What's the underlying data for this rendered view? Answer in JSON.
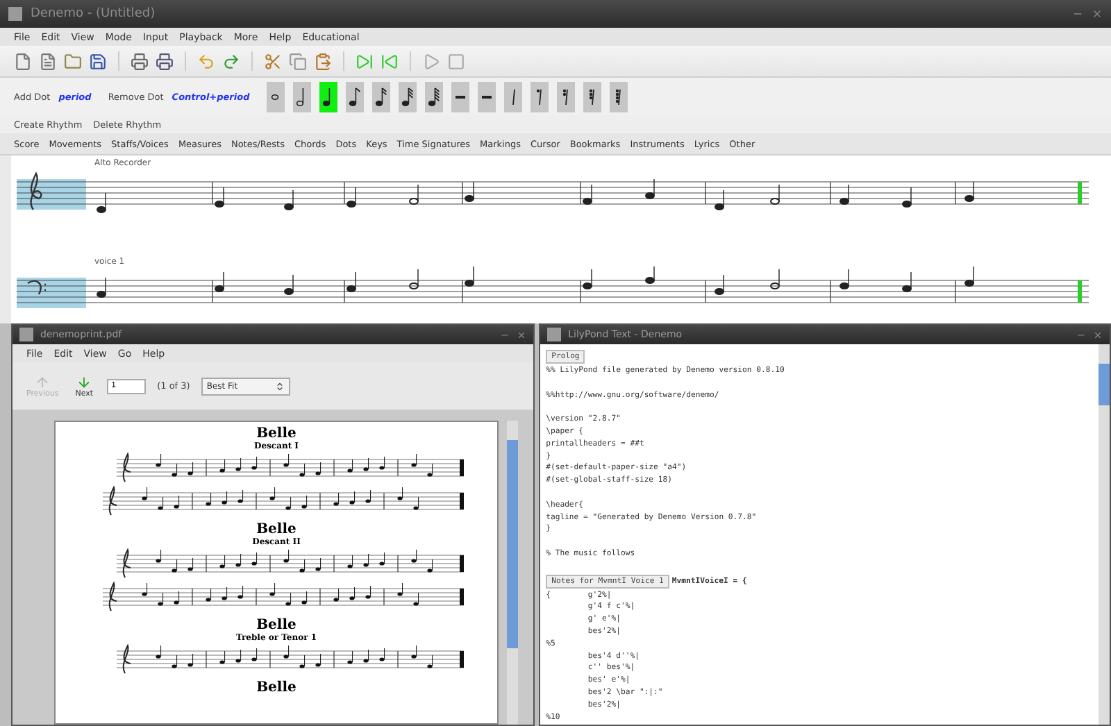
{
  "window": {
    "title": "Denemo - (Untitled)"
  },
  "menu": [
    "File",
    "Edit",
    "View",
    "Mode",
    "Input",
    "Playback",
    "More",
    "Help",
    "Educational"
  ],
  "rhythm_bar": {
    "add_dot": {
      "label": "Add Dot",
      "shortcut": "period"
    },
    "remove_dot": {
      "label": "Remove Dot",
      "shortcut": "Control+period"
    },
    "buttons": [
      {
        "kind": "whole-note",
        "selected": false
      },
      {
        "kind": "half-note",
        "selected": false
      },
      {
        "kind": "quarter-note",
        "selected": true
      },
      {
        "kind": "eighth-note",
        "selected": false
      },
      {
        "kind": "sixteenth-note",
        "selected": false
      },
      {
        "kind": "thirty-second-note",
        "selected": false
      },
      {
        "kind": "sixty-fourth-note",
        "selected": false
      },
      {
        "kind": "whole-rest",
        "selected": false
      },
      {
        "kind": "half-rest",
        "selected": false
      },
      {
        "kind": "quarter-rest",
        "selected": false
      },
      {
        "kind": "eighth-rest",
        "selected": false
      },
      {
        "kind": "sixteenth-rest",
        "selected": false
      },
      {
        "kind": "thirty-second-rest",
        "selected": false
      },
      {
        "kind": "sixty-fourth-rest",
        "selected": false
      }
    ]
  },
  "rhythm_actions": [
    "Create Rhythm",
    "Delete Rhythm"
  ],
  "tabs": [
    "Score",
    "Movements",
    "Staffs/Voices",
    "Measures",
    "Notes/Rests",
    "Chords",
    "Dots",
    "Keys",
    "Time Signatures",
    "Markings",
    "Cursor",
    "Bookmarks",
    "Instruments",
    "Lyrics",
    "Other"
  ],
  "score": {
    "staves": [
      {
        "label": "Alto Recorder",
        "kind": "treble"
      },
      {
        "label": "voice 1",
        "kind": "bass"
      }
    ]
  },
  "pdf_viewer": {
    "title": "denemoprint.pdf",
    "menu": [
      "File",
      "Edit",
      "View",
      "Go",
      "Help"
    ],
    "previous": {
      "label": "Previous",
      "disabled": true
    },
    "next": {
      "label": "Next",
      "disabled": false
    },
    "page": "1",
    "page_count": "(1 of 3)",
    "zoom": "Best Fit",
    "sections": [
      {
        "title": "Belle",
        "subtitle": "Descant I",
        "staves": [
          {
            "kind": "opening"
          },
          {
            "kind": "continuation"
          }
        ]
      },
      {
        "title": "Belle",
        "subtitle": "Descant II",
        "staves": [
          {
            "kind": "opening"
          },
          {
            "kind": "continuation"
          }
        ]
      },
      {
        "title": "Belle",
        "subtitle": "Treble or Tenor 1",
        "staves": [
          {
            "kind": "opening"
          }
        ]
      },
      {
        "title": "Belle"
      }
    ]
  },
  "lilypond": {
    "title": "LilyPond Text - Denemo",
    "prolog_button": "Prolog",
    "blocks": [
      [
        "%% LilyPond file generated by Denemo version 0.8.10"
      ],
      [
        "%%http://www.gnu.org/software/denemo/"
      ],
      [
        "\\version \"2.8.7\"",
        "\\paper {",
        "printallheaders = ##t",
        "}",
        "#(set-default-paper-size \"a4\")",
        "#(set-global-staff-size 18)"
      ],
      [
        "\\header{",
        "tagline = \"Generated by Denemo Version 0.7.8\"",
        "}"
      ],
      [
        "% The music follows"
      ]
    ],
    "notes_button": "Notes for MvmntI Voice 1",
    "notes_heading": "MvmntIVoiceI = {",
    "body": [
      "{        g'2%|",
      "         g'4 f c'%|",
      "         g' e'%|",
      "         bes'2%|",
      "%5",
      "         bes'4 d''%|",
      "         c'' bes'%|",
      "         bes' e'%|",
      "         bes'2 \\bar \":|:\"",
      "         bes'2%|",
      "%10"
    ]
  }
}
